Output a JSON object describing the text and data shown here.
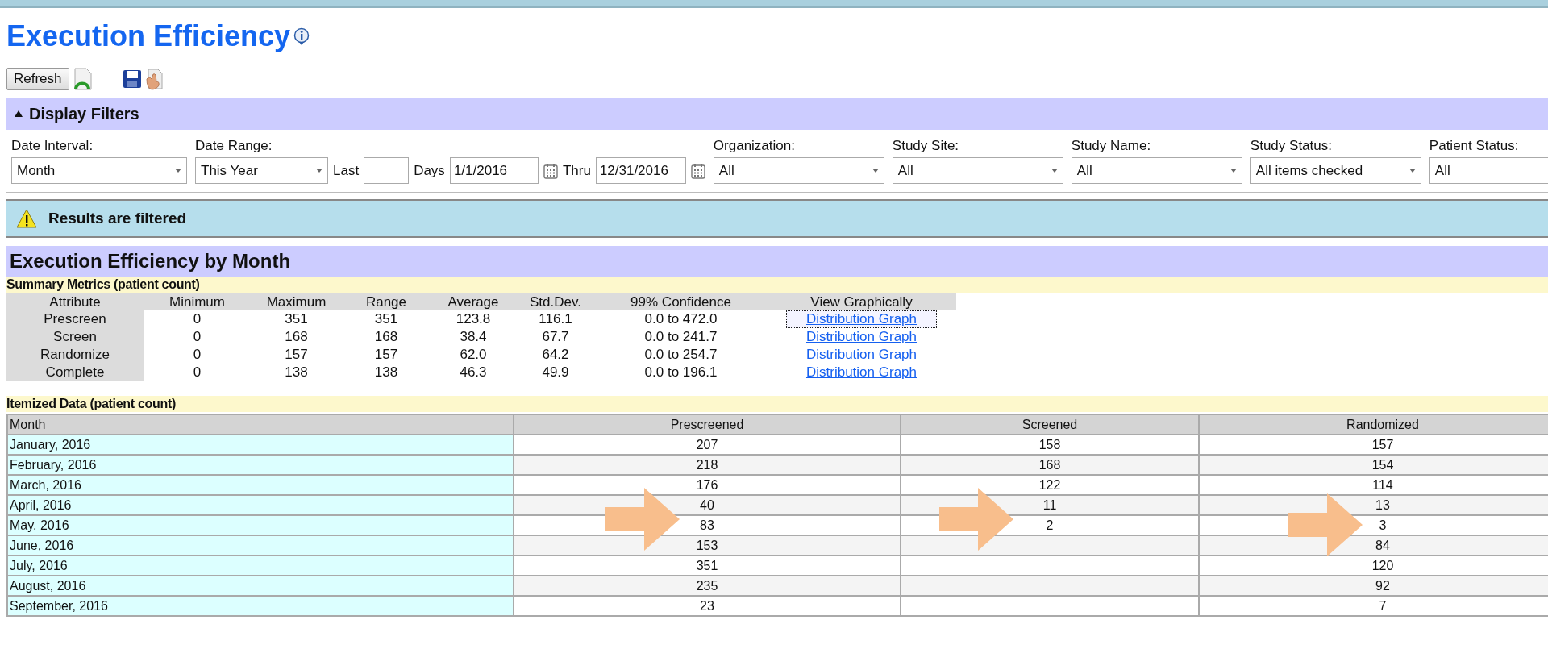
{
  "title": "Execution Efficiency",
  "toolbar": {
    "refresh": "Refresh"
  },
  "filters_panel": {
    "title": "Display Filters",
    "expanded": true,
    "filters": [
      {
        "kind": "select",
        "label": "Date Interval:",
        "value": "Month"
      },
      {
        "kind": "date-range",
        "label": "Date Range:",
        "value": "This Year",
        "last_label": "Last",
        "days_label": "Days",
        "from": "1/1/2016",
        "thru_label": "Thru",
        "to": "12/31/2016"
      },
      {
        "kind": "select",
        "label": "Organization:",
        "value": "All"
      },
      {
        "kind": "select",
        "label": "Study Site:",
        "value": "All"
      },
      {
        "kind": "select",
        "label": "Study Name:",
        "value": "All"
      },
      {
        "kind": "select",
        "label": "Study Status:",
        "value": "All items checked"
      },
      {
        "kind": "select",
        "label": "Patient Status:",
        "value": "All"
      }
    ]
  },
  "notice": "Results are filtered",
  "section_title": "Execution Efficiency by Month",
  "summary": {
    "title": "Summary Metrics (patient count)",
    "columns": [
      "Attribute",
      "Minimum",
      "Maximum",
      "Range",
      "Average",
      "Std.Dev.",
      "99% Confidence",
      "View Graphically"
    ],
    "rows": [
      {
        "cells": [
          "Prescreen",
          "0",
          "351",
          "351",
          "123.8",
          "116.1",
          "0.0 to 472.0"
        ],
        "link": "Distribution Graph",
        "focused": true
      },
      {
        "cells": [
          "Screen",
          "0",
          "168",
          "168",
          "38.4",
          "67.7",
          "0.0 to 241.7"
        ],
        "link": "Distribution Graph",
        "focused": false
      },
      {
        "cells": [
          "Randomize",
          "0",
          "157",
          "157",
          "62.0",
          "64.2",
          "0.0 to 254.7"
        ],
        "link": "Distribution Graph",
        "focused": false
      },
      {
        "cells": [
          "Complete",
          "0",
          "138",
          "138",
          "46.3",
          "49.9",
          "0.0 to 196.1"
        ],
        "link": "Distribution Graph",
        "focused": false
      }
    ]
  },
  "itemized": {
    "title": "Itemized Data (patient count)",
    "columns": [
      "Month",
      "Prescreened",
      "Screened",
      "Randomized"
    ],
    "rows": [
      {
        "cells": [
          "January, 2016",
          "207",
          "158",
          "157"
        ]
      },
      {
        "cells": [
          "February, 2016",
          "218",
          "168",
          "154"
        ]
      },
      {
        "cells": [
          "March, 2016",
          "176",
          "122",
          "114"
        ]
      },
      {
        "cells": [
          "April, 2016",
          "40",
          "11",
          "13"
        ]
      },
      {
        "cells": [
          "May, 2016",
          "83",
          "2",
          "3"
        ]
      },
      {
        "cells": [
          "June, 2016",
          "153",
          null,
          "84"
        ]
      },
      {
        "cells": [
          "July, 2016",
          "351",
          null,
          "120"
        ]
      },
      {
        "cells": [
          "August, 2016",
          "235",
          null,
          "92"
        ]
      },
      {
        "cells": [
          "September, 2016",
          "23",
          null,
          "7"
        ]
      }
    ]
  }
}
